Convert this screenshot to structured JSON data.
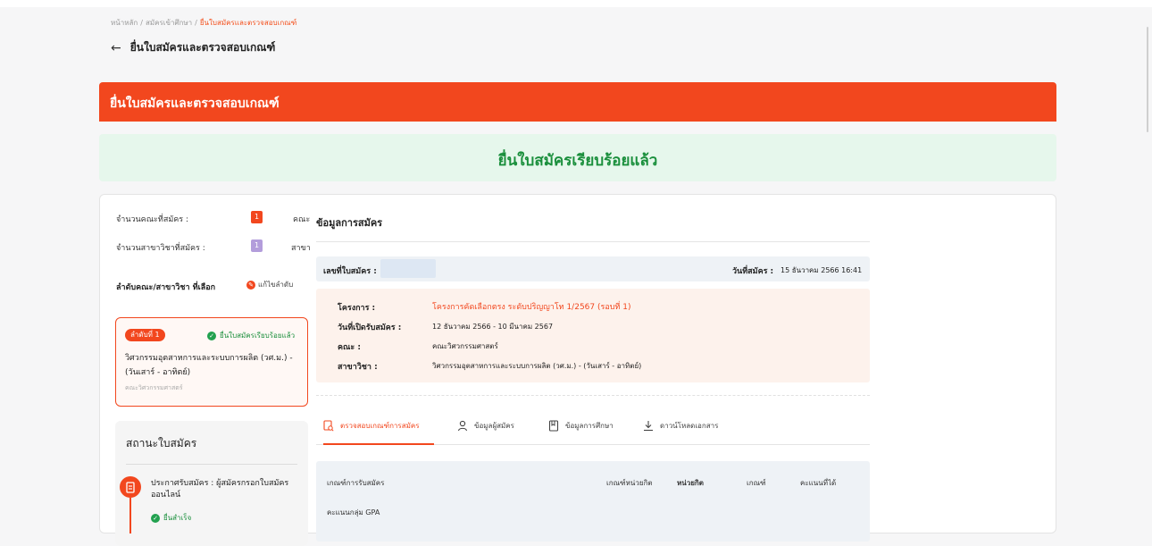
{
  "breadcrumb": {
    "home": "หน้าหลัก",
    "second": "สมัครเข้าศึกษา",
    "current": "ยื่นใบสมัครและตรวจสอบเกณฑ์",
    "sep": "/"
  },
  "page": {
    "back_icon": "arrow-left-icon",
    "back_arrow": "←",
    "title": "ยื่นใบสมัครและตรวจสอบเกณฑ์"
  },
  "header_bar": {
    "title": "ยื่นใบสมัครและตรวจสอบเกณฑ์"
  },
  "success": {
    "message": "ยื่นใบสมัครเรียบร้อยแล้ว"
  },
  "left": {
    "faculty_count_label": "จำนวนคณะที่สมัคร :",
    "faculty_count": "1",
    "faculty_unit": "คณะ",
    "major_count_label": "จำนวนสาขาวิชาที่สมัคร :",
    "major_count": "1",
    "major_unit": "สาขา",
    "order_label": "ลำดับคณะ/สาขาวิชา ที่เลือก",
    "edit_order": "แก้ไขลำดับ",
    "choice": {
      "rank": "ลำดับที่ 1",
      "status": "ยื่นใบสมัครเรียบร้อยแล้ว",
      "major": "วิศวกรรมอุตสาหการและระบบการผลิต (วศ.ม.) - (วันเสาร์ - อาทิตย์)",
      "faculty": "คณะวิศวกรรมศาสตร์"
    },
    "status_box": {
      "title": "สถานะใบสมัคร",
      "step_text": "ประกาศรับสมัคร : ผู้สมัครกรอกใบสมัครออนไลน์",
      "step_status": "ยื่นสำเร็จ"
    }
  },
  "right": {
    "section_title": "ข้อมูลการสมัคร",
    "app_no_label": "เลขที่ใบสมัคร :",
    "app_date_label": "วันที่สมัคร :",
    "app_date": "15 ธันวาคม 2566 16:41",
    "info": {
      "project_label": "โครงการ :",
      "project": "โครงการคัดเลือกตรง ระดับปริญญาโท 1/2567 (รอบที่ 1)",
      "period_label": "วันที่เปิดรับสมัคร :",
      "period": "12 ธันวาคม 2566 - 10 มีนาคม 2567",
      "faculty_label": "คณะ :",
      "faculty": "คณะวิศวกรรมศาสตร์",
      "major_label": "สาขาวิชา :",
      "major": "วิศวกรรมอุตสาหการและระบบการผลิต (วศ.ม.) - (วันเสาร์ - อาทิตย์)"
    },
    "tabs": [
      {
        "label": "ตรวจสอบเกณฑ์การสมัคร",
        "icon": "search-document-icon"
      },
      {
        "label": "ข้อมูลผู้สมัคร",
        "icon": "user-icon"
      },
      {
        "label": "ข้อมูลการศึกษา",
        "icon": "book-icon"
      },
      {
        "label": "ดาวน์โหลดเอกสาร",
        "icon": "download-icon"
      }
    ],
    "criteria": {
      "headers": [
        "เกณฑ์การรับสมัคร",
        "เกณฑ์หน่วยกิต",
        "หน่วยกิต",
        "เกณฑ์",
        "คะแนนที่ได้"
      ],
      "row1": "คะแนนกลุ่ม GPA"
    }
  },
  "colors": {
    "accent": "#f2471e",
    "success": "#1a8f3c",
    "success_bg": "#e6f7ec",
    "purple": "#b39ddb"
  }
}
